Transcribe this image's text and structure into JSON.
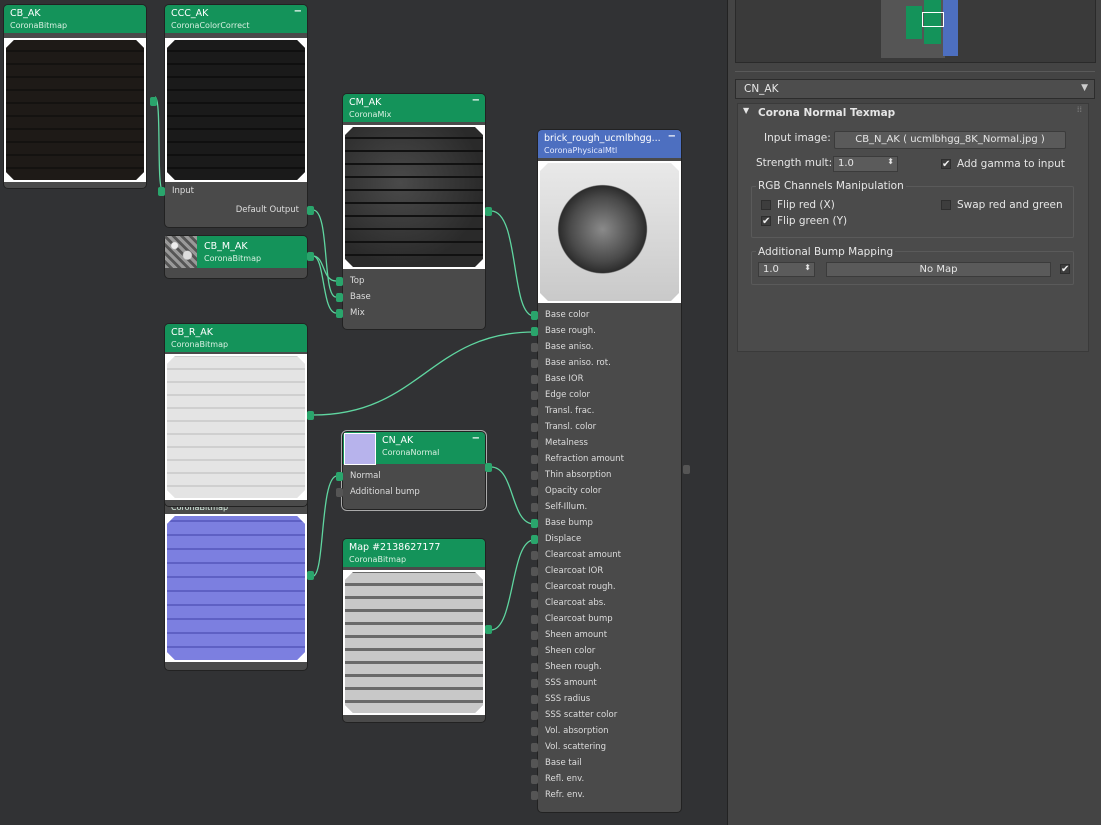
{
  "editor": {
    "nodes": {
      "cb_ak": {
        "title": "CB_AK",
        "type": "CoronaBitmap"
      },
      "ccc_ak": {
        "title": "CCC_AK",
        "type": "CoronaColorCorrect",
        "inputs": [
          "Input"
        ],
        "output": "Default Output"
      },
      "cb_m_ak": {
        "title": "CB_M_AK",
        "type": "CoronaBitmap"
      },
      "cm_ak": {
        "title": "CM_AK",
        "type": "CoronaMix",
        "inputs": [
          "Top",
          "Base",
          "Mix"
        ]
      },
      "cb_r_ak": {
        "title": "CB_R_AK",
        "type": "CoronaBitmap"
      },
      "cb_n_ak": {
        "type": "CoronaBitmap"
      },
      "cn_ak": {
        "title": "CN_AK",
        "type": "CoronaNormal",
        "inputs": [
          "Normal",
          "Additional bump"
        ]
      },
      "map": {
        "title": "Map #2138627177",
        "type": "CoronaBitmap"
      },
      "mtl": {
        "title": "brick_rough_ucmlbhgg...",
        "type": "CoronaPhysicalMtl",
        "slots": [
          "Base color",
          "Base rough.",
          "Base aniso.",
          "Base aniso. rot.",
          "Base IOR",
          "Edge color",
          "Transl. frac.",
          "Transl. color",
          "Metalness",
          "Refraction amount",
          "Thin absorption",
          "Opacity color",
          "Self-Illum.",
          "Base bump",
          "Displace",
          "Clearcoat amount",
          "Clearcoat IOR",
          "Clearcoat rough.",
          "Clearcoat abs.",
          "Clearcoat bump",
          "Sheen amount",
          "Sheen color",
          "Sheen rough.",
          "SSS amount",
          "SSS radius",
          "SSS scatter color",
          "Vol. absorption",
          "Vol. scattering",
          "Base tail",
          "Refl. env.",
          "Refr. env."
        ],
        "connected": [
          0,
          1,
          13,
          14
        ]
      }
    }
  },
  "panel": {
    "node_selector": "CN_AK",
    "rollout_title": "Corona Normal Texmap",
    "input_image_label": "Input image:",
    "input_image_value": "CB_N_AK ( ucmlbhgg_8K_Normal.jpg )",
    "strength_label": "Strength mult:",
    "strength_value": "1.0",
    "add_gamma_label": "Add gamma to input",
    "add_gamma_checked": true,
    "rgb_group_label": "RGB Channels Manipulation",
    "flip_red_label": "Flip red (X)",
    "flip_red_checked": false,
    "flip_green_label": "Flip green (Y)",
    "flip_green_checked": true,
    "swap_label": "Swap red and green",
    "swap_checked": false,
    "bump_group_label": "Additional Bump Mapping",
    "bump_amount": "1.0",
    "bump_map": "No Map",
    "bump_enabled": true
  },
  "colors": {
    "node_header": "#14935a",
    "mtl_header": "#4d6fc0",
    "wire": "#5fd6a0"
  }
}
